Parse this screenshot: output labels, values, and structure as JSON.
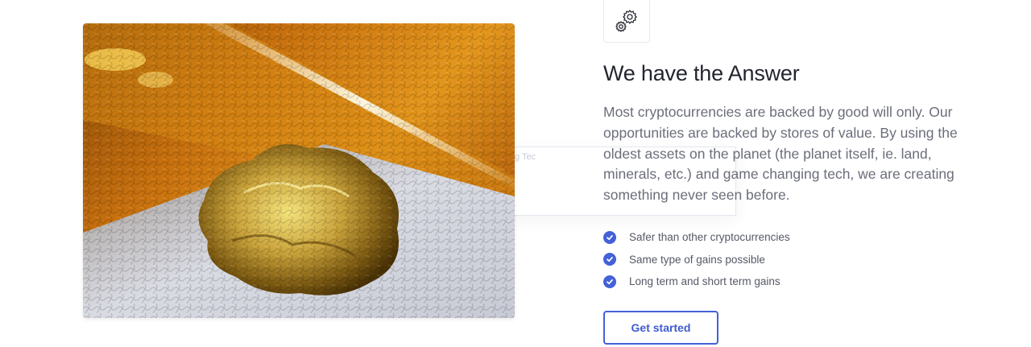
{
  "feature_section": {
    "overlay_caption": "g Tec",
    "heading": "We have the Answer",
    "paragraph": "Most cryptocurrencies are backed by good will only. Our opportunities are backed by stores of value. By using the oldest assets on the planet (the planet itself, ie. land, minerals, etc.) and game changing tech, we are creating something never seen before.",
    "features": [
      "Safer than other cryptocurrencies",
      "Same type of gains possible",
      "Long term and short term gains"
    ],
    "cta_label": "Get started",
    "icon": "gears-icon",
    "check_icon": "check-circle-icon",
    "image": "gold-nugget-photo"
  },
  "colors": {
    "accent": "#4361d8",
    "heading": "#23252f",
    "body_text": "#6b6e7a"
  }
}
